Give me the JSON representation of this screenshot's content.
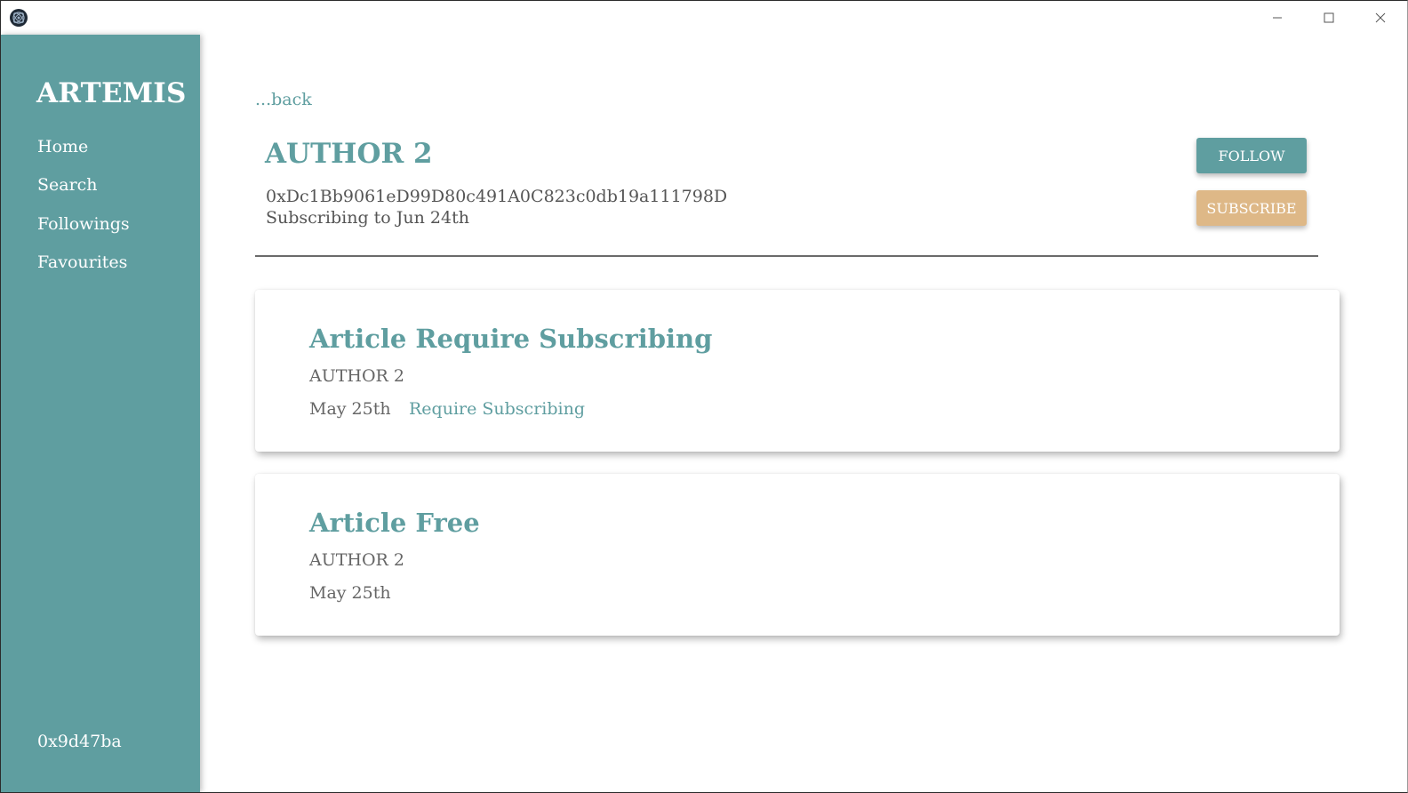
{
  "window": {
    "minimize_icon": "minimize-icon",
    "maximize_icon": "maximize-icon",
    "close_icon": "close-icon"
  },
  "sidebar": {
    "brand": "ARTEMIS",
    "items": [
      {
        "label": "Home"
      },
      {
        "label": "Search"
      },
      {
        "label": "Followings"
      },
      {
        "label": "Favourites"
      }
    ],
    "wallet": "0x9d47ba"
  },
  "main": {
    "back_label": "...back",
    "author": {
      "name": "AUTHOR 2",
      "address": "0xDc1Bb9061eD99D80c491A0C823c0db19a111798D",
      "subscription_status": "Subscribing to Jun 24th"
    },
    "buttons": {
      "follow_label": "FOLLOW",
      "subscribe_label": "SUBSCRIBE"
    },
    "articles": [
      {
        "title": "Article Require Subscribing",
        "author": "AUTHOR 2",
        "date": "May 25th",
        "tag": "Require Subscribing"
      },
      {
        "title": "Article Free",
        "author": "AUTHOR 2",
        "date": "May 25th"
      }
    ]
  },
  "colors": {
    "primary": "#5f9ea0",
    "subscribe": "#deb887",
    "text_muted": "#666666"
  }
}
